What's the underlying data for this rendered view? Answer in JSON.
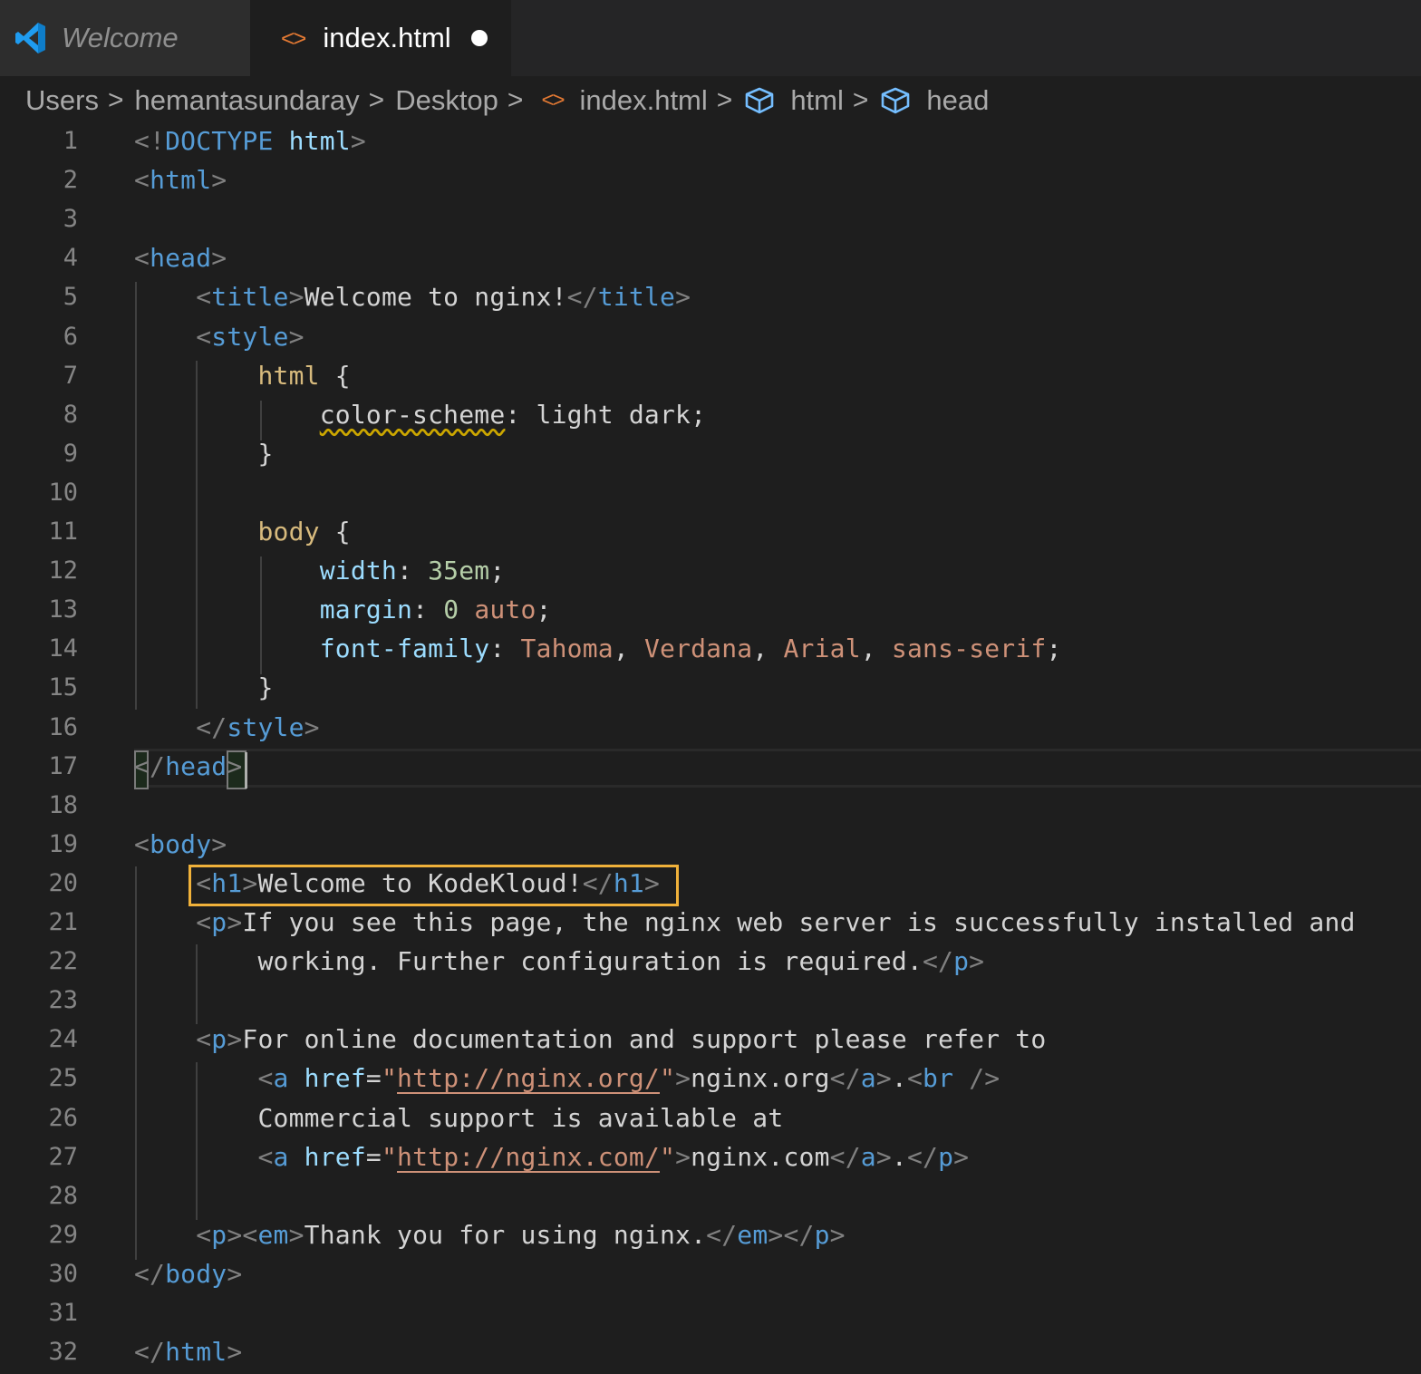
{
  "tabs": [
    {
      "label": "Welcome",
      "icon": "vscode-logo-icon",
      "active": false
    },
    {
      "label": "index.html",
      "icon": "html-code-icon",
      "active": true,
      "unsaved": true
    }
  ],
  "breadcrumb": [
    {
      "label": "Users",
      "icon": null
    },
    {
      "label": "hemantasundaray",
      "icon": null
    },
    {
      "label": "Desktop",
      "icon": null
    },
    {
      "label": "index.html",
      "icon": "html-code-icon"
    },
    {
      "label": "html",
      "icon": "symbol-cube-icon"
    },
    {
      "label": "head",
      "icon": "symbol-cube-icon"
    }
  ],
  "colors": {
    "background": "#1e1e1e",
    "tag": "#569cd6",
    "punctuation": "#808080",
    "attribute": "#9cdcfe",
    "string": "#ce9178",
    "selector": "#d7ba7d",
    "number": "#b5cea8",
    "highlight_border": "#f0b13a",
    "warning_squiggle": "#cca700",
    "line_number": "#858585"
  },
  "editor": {
    "cursor_line": 17,
    "highlighted_line": 20,
    "lines": [
      {
        "n": "1",
        "text": "<!DOCTYPE html>"
      },
      {
        "n": "2",
        "text": "<html>"
      },
      {
        "n": "3",
        "text": ""
      },
      {
        "n": "4",
        "text": "<head>"
      },
      {
        "n": "5",
        "text": "    <title>Welcome to nginx!</title>"
      },
      {
        "n": "6",
        "text": "    <style>"
      },
      {
        "n": "7",
        "text": "        html {"
      },
      {
        "n": "8",
        "text": "            color-scheme: light dark;"
      },
      {
        "n": "9",
        "text": "        }"
      },
      {
        "n": "10",
        "text": ""
      },
      {
        "n": "11",
        "text": "        body {"
      },
      {
        "n": "12",
        "text": "            width: 35em;"
      },
      {
        "n": "13",
        "text": "            margin: 0 auto;"
      },
      {
        "n": "14",
        "text": "            font-family: Tahoma, Verdana, Arial, sans-serif;"
      },
      {
        "n": "15",
        "text": "        }"
      },
      {
        "n": "16",
        "text": "    </style>"
      },
      {
        "n": "17",
        "text": "</head>"
      },
      {
        "n": "18",
        "text": ""
      },
      {
        "n": "19",
        "text": "<body>"
      },
      {
        "n": "20",
        "text": "    <h1>Welcome to KodeKloud!</h1>"
      },
      {
        "n": "21",
        "text": "    <p>If you see this page, the nginx web server is successfully installed and"
      },
      {
        "n": "22",
        "text": "        working. Further configuration is required.</p>"
      },
      {
        "n": "23",
        "text": ""
      },
      {
        "n": "24",
        "text": "    <p>For online documentation and support please refer to"
      },
      {
        "n": "25",
        "text": "        <a href=\"http://nginx.org/\">nginx.org</a>.<br />"
      },
      {
        "n": "26",
        "text": "        Commercial support is available at"
      },
      {
        "n": "27",
        "text": "        <a href=\"http://nginx.com/\">nginx.com</a>.</p>"
      },
      {
        "n": "28",
        "text": ""
      },
      {
        "n": "29",
        "text": "    <p><em>Thank you for using nginx.</em></p>"
      },
      {
        "n": "30",
        "text": "</body>"
      },
      {
        "n": "31",
        "text": ""
      },
      {
        "n": "32",
        "text": "</html>"
      }
    ]
  }
}
